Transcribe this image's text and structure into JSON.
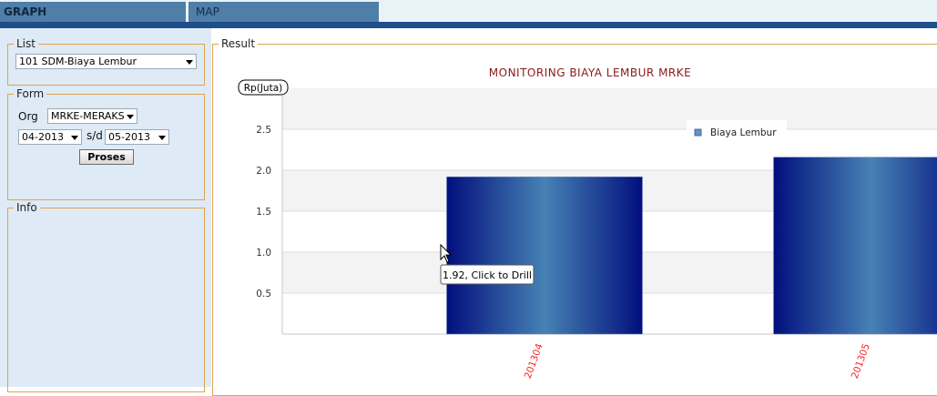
{
  "tabs": [
    {
      "label": "GRAPH",
      "active": true
    },
    {
      "label": "MAP",
      "active": false
    }
  ],
  "panels": {
    "list": {
      "title": "List",
      "selected": "101 SDM-Biaya Lembur"
    },
    "form": {
      "title": "Form",
      "org_label": "Org",
      "org_value": "MRKE-MERAKS",
      "from_value": "04-2013",
      "sd_label": "s/d",
      "to_value": "05-2013",
      "button_label": "Proses"
    },
    "info": {
      "title": "Info"
    },
    "result": {
      "title": "Result"
    }
  },
  "colors": {
    "accent": "#1e4f8b",
    "bar_edge": "#020f7d",
    "bar_center": "#4682b4",
    "title": "#8b1a1a",
    "x_tick": "#ff2020"
  },
  "tooltip": "1.92, Click to Drill",
  "chart_data": {
    "type": "bar",
    "title": "MONITORING BIAYA LEMBUR MRKE",
    "ylabel": "Rp(Juta)",
    "xlabel": "",
    "categories": [
      "201304",
      "201305"
    ],
    "series": [
      {
        "name": "Biaya Lembur",
        "values": [
          1.92,
          2.16
        ]
      }
    ],
    "ylim": [
      0,
      3.0
    ],
    "yticks": [
      "0.5",
      "1.0",
      "1.5",
      "2.0",
      "2.5"
    ],
    "grid": true,
    "legend_position": "top-right"
  }
}
